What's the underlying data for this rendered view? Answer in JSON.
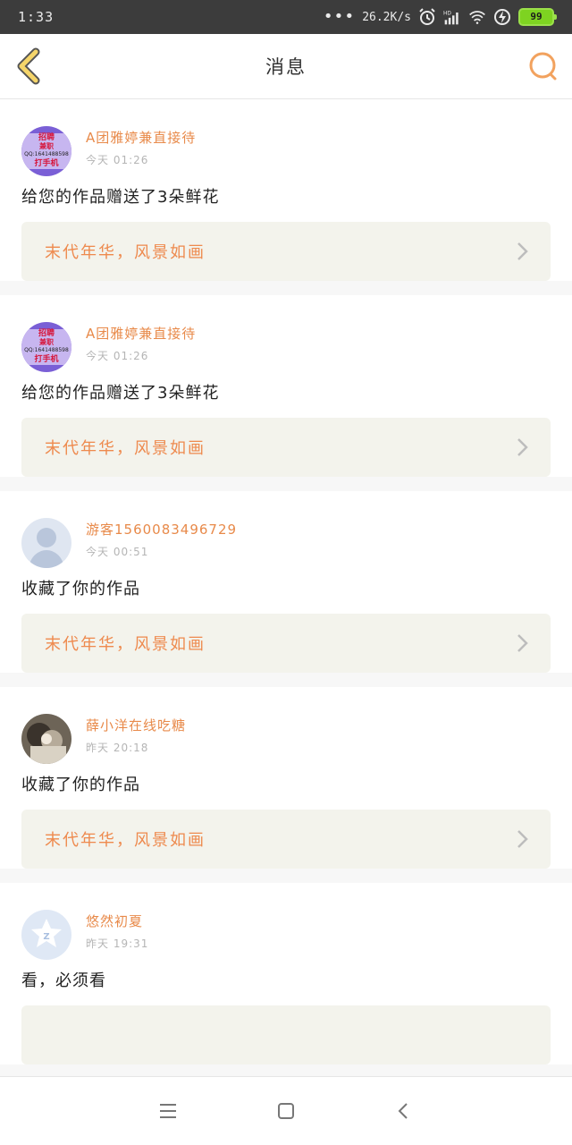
{
  "status": {
    "time": "1:33",
    "speed": "26.2K/s",
    "battery": "99",
    "dots": "•••"
  },
  "header": {
    "title": "消息"
  },
  "messages": [
    {
      "name": "A团雅婷兼直接待",
      "time": "今天 01:26",
      "text": "给您的作品赠送了3朵鲜花",
      "work": "末代年华，风景如画",
      "avatar_type": "ad"
    },
    {
      "name": "A团雅婷兼直接待",
      "time": "今天 01:26",
      "text": "给您的作品赠送了3朵鲜花",
      "work": "末代年华，风景如画",
      "avatar_type": "ad"
    },
    {
      "name": "游客1560083496729",
      "time": "今天 00:51",
      "text": "收藏了你的作品",
      "work": "末代年华，风景如画",
      "avatar_type": "guest"
    },
    {
      "name": "薛小洋在线吃糖",
      "time": "昨天 20:18",
      "text": "收藏了你的作品",
      "work": "末代年华，风景如画",
      "avatar_type": "photo"
    },
    {
      "name": "悠然初夏",
      "time": "昨天 19:31",
      "text": "看，必须看",
      "work": "",
      "avatar_type": "qzone"
    }
  ],
  "ad_avatar_text": {
    "line1": "招聘",
    "line2": "兼职",
    "line3": "QQ:1641488598",
    "line4": "打手机"
  },
  "colors": {
    "accent": "#e88a4a",
    "back_icon": "#f5d56a",
    "search_icon": "#f2a25e",
    "card_bg": "#f3f3ec"
  }
}
